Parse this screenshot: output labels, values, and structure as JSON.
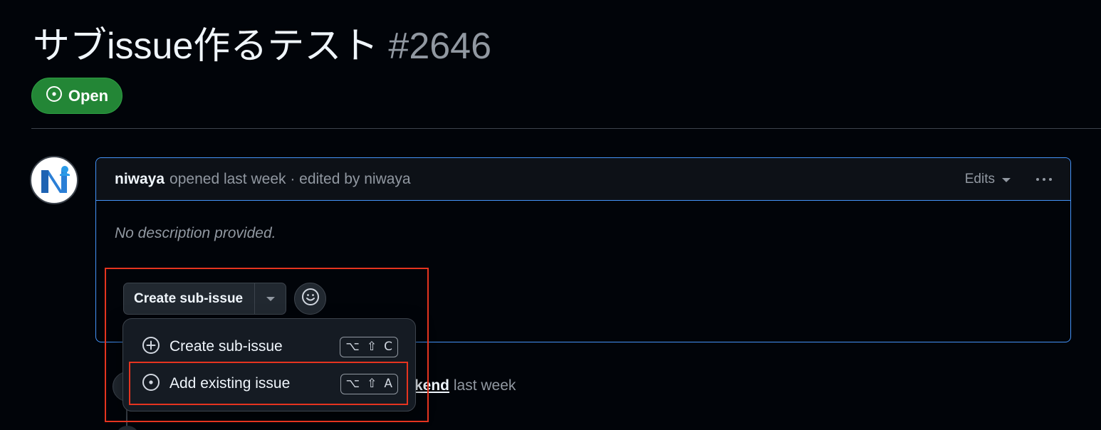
{
  "issue": {
    "title": "サブissue作るテスト",
    "number": "#2646",
    "state": "Open",
    "state_color": "#238636"
  },
  "comment": {
    "author": "niwaya",
    "meta": "opened last week · edited by niwaya",
    "edits_label": "Edits",
    "body": "No description provided.",
    "accent": "#4493f8"
  },
  "actions": {
    "create_sub_issue": "Create sub-issue"
  },
  "menu": {
    "items": [
      {
        "label": "Create sub-issue",
        "icon": "plus-circle-icon",
        "shortcut": [
          "⌥",
          "⇧",
          "C"
        ]
      },
      {
        "label": "Add existing issue",
        "icon": "issue-opened-icon",
        "shortcut": [
          "⌥",
          "⇧",
          "A"
        ]
      }
    ]
  },
  "timeline": {
    "link_fragment": "kend",
    "suffix": "last week"
  },
  "annotation_color": "#e5341f"
}
